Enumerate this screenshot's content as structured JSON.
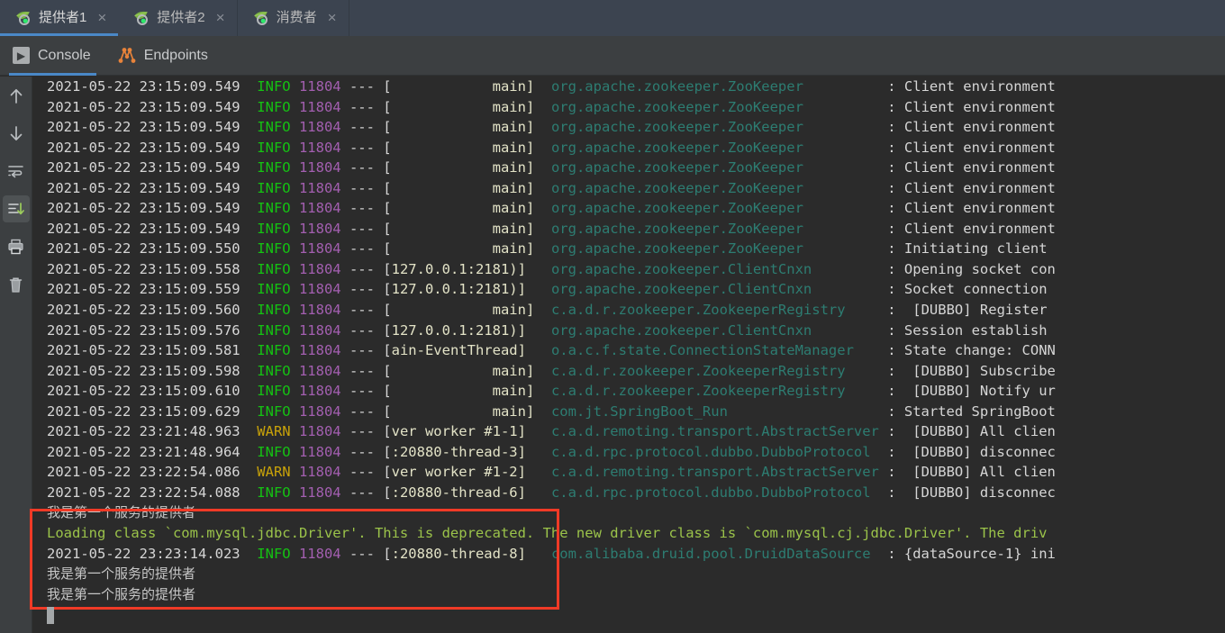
{
  "window": {
    "theme_bg": "#2b2b2b",
    "accent": "#4a88c7",
    "highlight_box_color": "#f03a26"
  },
  "run_tabs": {
    "items": [
      {
        "label": "提供者1",
        "icon": "spring-boot-leaf-icon",
        "close_glyph": "×",
        "active": true
      },
      {
        "label": "提供者2",
        "icon": "spring-boot-leaf-icon",
        "close_glyph": "×",
        "active": false
      },
      {
        "label": "消费者",
        "icon": "spring-boot-leaf-icon",
        "close_glyph": "×",
        "active": false
      }
    ]
  },
  "view_tabs": {
    "items": [
      {
        "label": "Console",
        "icon": "console-play-icon",
        "active": true
      },
      {
        "label": "Endpoints",
        "icon": "endpoints-graph-icon",
        "active": false
      }
    ]
  },
  "gutter_toolbar": {
    "buttons": [
      {
        "name": "up-arrow-icon",
        "title": "Up",
        "active": false
      },
      {
        "name": "down-arrow-icon",
        "title": "Down",
        "active": false
      },
      {
        "name": "soft-wrap-icon",
        "title": "Soft-Wrap",
        "active": false
      },
      {
        "name": "scroll-to-end-icon",
        "title": "Scroll to End",
        "active": true
      },
      {
        "name": "print-icon",
        "title": "Print",
        "active": false
      },
      {
        "name": "trash-icon",
        "title": "Clear All",
        "active": false
      }
    ]
  },
  "console": {
    "lines": [
      {
        "kind": "log",
        "ts": "2021-05-22 23:15:09.549",
        "level": "INFO",
        "pid": "11804",
        "thread": "            main]",
        "logger": "org.apache.zookeeper.ZooKeeper",
        "message": "Client environment"
      },
      {
        "kind": "log",
        "ts": "2021-05-22 23:15:09.549",
        "level": "INFO",
        "pid": "11804",
        "thread": "            main]",
        "logger": "org.apache.zookeeper.ZooKeeper",
        "message": "Client environment"
      },
      {
        "kind": "log",
        "ts": "2021-05-22 23:15:09.549",
        "level": "INFO",
        "pid": "11804",
        "thread": "            main]",
        "logger": "org.apache.zookeeper.ZooKeeper",
        "message": "Client environment"
      },
      {
        "kind": "log",
        "ts": "2021-05-22 23:15:09.549",
        "level": "INFO",
        "pid": "11804",
        "thread": "            main]",
        "logger": "org.apache.zookeeper.ZooKeeper",
        "message": "Client environment"
      },
      {
        "kind": "log",
        "ts": "2021-05-22 23:15:09.549",
        "level": "INFO",
        "pid": "11804",
        "thread": "            main]",
        "logger": "org.apache.zookeeper.ZooKeeper",
        "message": "Client environment"
      },
      {
        "kind": "log",
        "ts": "2021-05-22 23:15:09.549",
        "level": "INFO",
        "pid": "11804",
        "thread": "            main]",
        "logger": "org.apache.zookeeper.ZooKeeper",
        "message": "Client environment"
      },
      {
        "kind": "log",
        "ts": "2021-05-22 23:15:09.549",
        "level": "INFO",
        "pid": "11804",
        "thread": "            main]",
        "logger": "org.apache.zookeeper.ZooKeeper",
        "message": "Client environment"
      },
      {
        "kind": "log",
        "ts": "2021-05-22 23:15:09.549",
        "level": "INFO",
        "pid": "11804",
        "thread": "            main]",
        "logger": "org.apache.zookeeper.ZooKeeper",
        "message": "Client environment"
      },
      {
        "kind": "log",
        "ts": "2021-05-22 23:15:09.550",
        "level": "INFO",
        "pid": "11804",
        "thread": "            main]",
        "logger": "org.apache.zookeeper.ZooKeeper",
        "message": "Initiating client"
      },
      {
        "kind": "log",
        "ts": "2021-05-22 23:15:09.558",
        "level": "INFO",
        "pid": "11804",
        "thread": "127.0.0.1:2181)]",
        "logger": "org.apache.zookeeper.ClientCnxn",
        "message": "Opening socket con"
      },
      {
        "kind": "log",
        "ts": "2021-05-22 23:15:09.559",
        "level": "INFO",
        "pid": "11804",
        "thread": "127.0.0.1:2181)]",
        "logger": "org.apache.zookeeper.ClientCnxn",
        "message": "Socket connection"
      },
      {
        "kind": "log",
        "ts": "2021-05-22 23:15:09.560",
        "level": "INFO",
        "pid": "11804",
        "thread": "            main]",
        "logger": "c.a.d.r.zookeeper.ZookeeperRegistry",
        "message": " [DUBBO] Register"
      },
      {
        "kind": "log",
        "ts": "2021-05-22 23:15:09.576",
        "level": "INFO",
        "pid": "11804",
        "thread": "127.0.0.1:2181)]",
        "logger": "org.apache.zookeeper.ClientCnxn",
        "message": "Session establish"
      },
      {
        "kind": "log",
        "ts": "2021-05-22 23:15:09.581",
        "level": "INFO",
        "pid": "11804",
        "thread": "ain-EventThread]",
        "logger": "o.a.c.f.state.ConnectionStateManager",
        "message": "State change: CONN"
      },
      {
        "kind": "log",
        "ts": "2021-05-22 23:15:09.598",
        "level": "INFO",
        "pid": "11804",
        "thread": "            main]",
        "logger": "c.a.d.r.zookeeper.ZookeeperRegistry",
        "message": " [DUBBO] Subscribe"
      },
      {
        "kind": "log",
        "ts": "2021-05-22 23:15:09.610",
        "level": "INFO",
        "pid": "11804",
        "thread": "            main]",
        "logger": "c.a.d.r.zookeeper.ZookeeperRegistry",
        "message": " [DUBBO] Notify ur"
      },
      {
        "kind": "log",
        "ts": "2021-05-22 23:15:09.629",
        "level": "INFO",
        "pid": "11804",
        "thread": "            main]",
        "logger": "com.jt.SpringBoot_Run",
        "message": "Started SpringBoot"
      },
      {
        "kind": "log",
        "ts": "2021-05-22 23:21:48.963",
        "level": "WARN",
        "pid": "11804",
        "thread": "ver worker #1-1]",
        "logger": "c.a.d.remoting.transport.AbstractServer",
        "message": " [DUBBO] All clien"
      },
      {
        "kind": "log",
        "ts": "2021-05-22 23:21:48.964",
        "level": "INFO",
        "pid": "11804",
        "thread": ":20880-thread-3]",
        "logger": "c.a.d.rpc.protocol.dubbo.DubboProtocol",
        "message": " [DUBBO] disconnec"
      },
      {
        "kind": "log",
        "ts": "2021-05-22 23:22:54.086",
        "level": "WARN",
        "pid": "11804",
        "thread": "ver worker #1-2]",
        "logger": "c.a.d.remoting.transport.AbstractServer",
        "message": " [DUBBO] All clien"
      },
      {
        "kind": "log",
        "ts": "2021-05-22 23:22:54.088",
        "level": "INFO",
        "pid": "11804",
        "thread": ":20880-thread-6]",
        "logger": "c.a.d.rpc.protocol.dubbo.DubboProtocol",
        "message": " [DUBBO] disconnec"
      },
      {
        "kind": "plain",
        "text": "我是第一个服务的提供者"
      },
      {
        "kind": "green",
        "text": "Loading class `com.mysql.jdbc.Driver'. This is deprecated. The new driver class is `com.mysql.cj.jdbc.Driver'. The driv"
      },
      {
        "kind": "log",
        "ts": "2021-05-22 23:23:14.023",
        "level": "INFO",
        "pid": "11804",
        "thread": ":20880-thread-8]",
        "logger": "com.alibaba.druid.pool.DruidDataSource",
        "message": "{dataSource-1} ini"
      },
      {
        "kind": "plain",
        "text": "我是第一个服务的提供者"
      },
      {
        "kind": "plain",
        "text": "我是第一个服务的提供者"
      }
    ]
  }
}
